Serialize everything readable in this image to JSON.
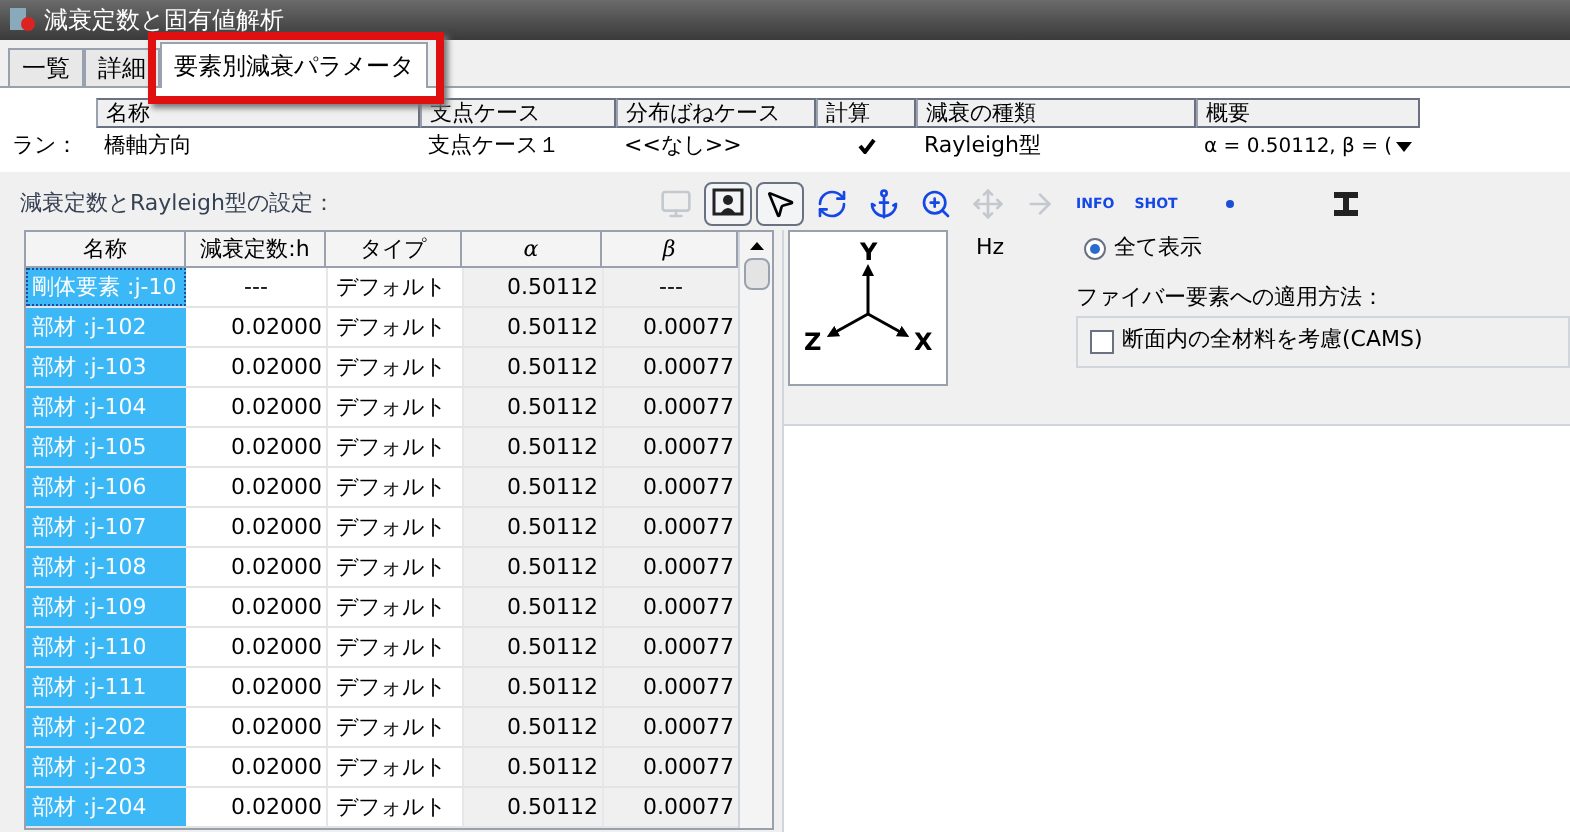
{
  "window": {
    "title": "減衰定数と固有値解析"
  },
  "tabs": [
    {
      "label": "一覧",
      "selected": false,
      "annotated": false
    },
    {
      "label": "詳細",
      "selected": false,
      "annotated": false
    },
    {
      "label": "要素別減衰パラメータ",
      "selected": true,
      "annotated": true
    }
  ],
  "run_table": {
    "row_label": "ラン：",
    "columns": [
      "名称",
      "支点ケース",
      "分布ばねケース",
      "計算",
      "減衰の種類",
      "概要"
    ],
    "row": {
      "name": "橋軸方向",
      "support_case": "支点ケース１",
      "spring_case": "<<なし>>",
      "compute": true,
      "damping_type": "Rayleigh型",
      "summary": "α = 0.50112, β = ("
    }
  },
  "settings_label": "減衰定数とRayleigh型の設定：",
  "toolbar": [
    {
      "kind": "windows",
      "disabled": true,
      "selected": false
    },
    {
      "kind": "view",
      "disabled": false,
      "selected": true
    },
    {
      "kind": "pointer",
      "disabled": false,
      "selected": true
    },
    {
      "kind": "rotate",
      "disabled": false,
      "selected": false
    },
    {
      "kind": "anchor",
      "disabled": false,
      "selected": false
    },
    {
      "kind": "zoom",
      "disabled": false,
      "selected": false
    },
    {
      "kind": "move",
      "disabled": true,
      "selected": false
    },
    {
      "kind": "arrow",
      "disabled": true,
      "selected": false
    },
    {
      "kind": "labeled",
      "label": "INFO",
      "disabled": false,
      "selected": false
    },
    {
      "kind": "labeled",
      "label": "SHOT",
      "disabled": false,
      "selected": false
    },
    {
      "kind": "dot",
      "disabled": false,
      "selected": false
    },
    {
      "kind": "beam",
      "disabled": false,
      "selected": false
    }
  ],
  "grid": {
    "columns": [
      "名称",
      "減衰定数:h",
      "タイプ",
      "α",
      "β"
    ],
    "rows": [
      {
        "name": "剛体要素 :j-10",
        "h": "---",
        "type": "デフォルト",
        "alpha": "0.50112",
        "beta": "---",
        "selected": true,
        "focused": true
      },
      {
        "name": "部材 :j-102",
        "h": "0.02000",
        "type": "デフォルト",
        "alpha": "0.50112",
        "beta": "0.00077",
        "selected": true,
        "focused": false
      },
      {
        "name": "部材 :j-103",
        "h": "0.02000",
        "type": "デフォルト",
        "alpha": "0.50112",
        "beta": "0.00077",
        "selected": true,
        "focused": false
      },
      {
        "name": "部材 :j-104",
        "h": "0.02000",
        "type": "デフォルト",
        "alpha": "0.50112",
        "beta": "0.00077",
        "selected": true,
        "focused": false
      },
      {
        "name": "部材 :j-105",
        "h": "0.02000",
        "type": "デフォルト",
        "alpha": "0.50112",
        "beta": "0.00077",
        "selected": true,
        "focused": false
      },
      {
        "name": "部材 :j-106",
        "h": "0.02000",
        "type": "デフォルト",
        "alpha": "0.50112",
        "beta": "0.00077",
        "selected": true,
        "focused": false
      },
      {
        "name": "部材 :j-107",
        "h": "0.02000",
        "type": "デフォルト",
        "alpha": "0.50112",
        "beta": "0.00077",
        "selected": true,
        "focused": false
      },
      {
        "name": "部材 :j-108",
        "h": "0.02000",
        "type": "デフォルト",
        "alpha": "0.50112",
        "beta": "0.00077",
        "selected": true,
        "focused": false
      },
      {
        "name": "部材 :j-109",
        "h": "0.02000",
        "type": "デフォルト",
        "alpha": "0.50112",
        "beta": "0.00077",
        "selected": true,
        "focused": false
      },
      {
        "name": "部材 :j-110",
        "h": "0.02000",
        "type": "デフォルト",
        "alpha": "0.50112",
        "beta": "0.00077",
        "selected": true,
        "focused": false
      },
      {
        "name": "部材 :j-111",
        "h": "0.02000",
        "type": "デフォルト",
        "alpha": "0.50112",
        "beta": "0.00077",
        "selected": true,
        "focused": false
      },
      {
        "name": "部材 :j-202",
        "h": "0.02000",
        "type": "デフォルト",
        "alpha": "0.50112",
        "beta": "0.00077",
        "selected": true,
        "focused": false
      },
      {
        "name": "部材 :j-203",
        "h": "0.02000",
        "type": "デフォルト",
        "alpha": "0.50112",
        "beta": "0.00077",
        "selected": true,
        "focused": false
      },
      {
        "name": "部材 :j-204",
        "h": "0.02000",
        "type": "デフォルト",
        "alpha": "0.50112",
        "beta": "0.00077",
        "selected": true,
        "focused": false
      }
    ]
  },
  "axes": {
    "y": "Y",
    "z": "Z",
    "x": "X"
  },
  "options": {
    "unit": "Hz",
    "radio": {
      "label": "全て表示",
      "selected": true
    },
    "fiber_label": "ファイバー要素への適用方法：",
    "checkbox": {
      "label": "断面内の全材料を考慮(CAMS)",
      "checked": false
    }
  }
}
